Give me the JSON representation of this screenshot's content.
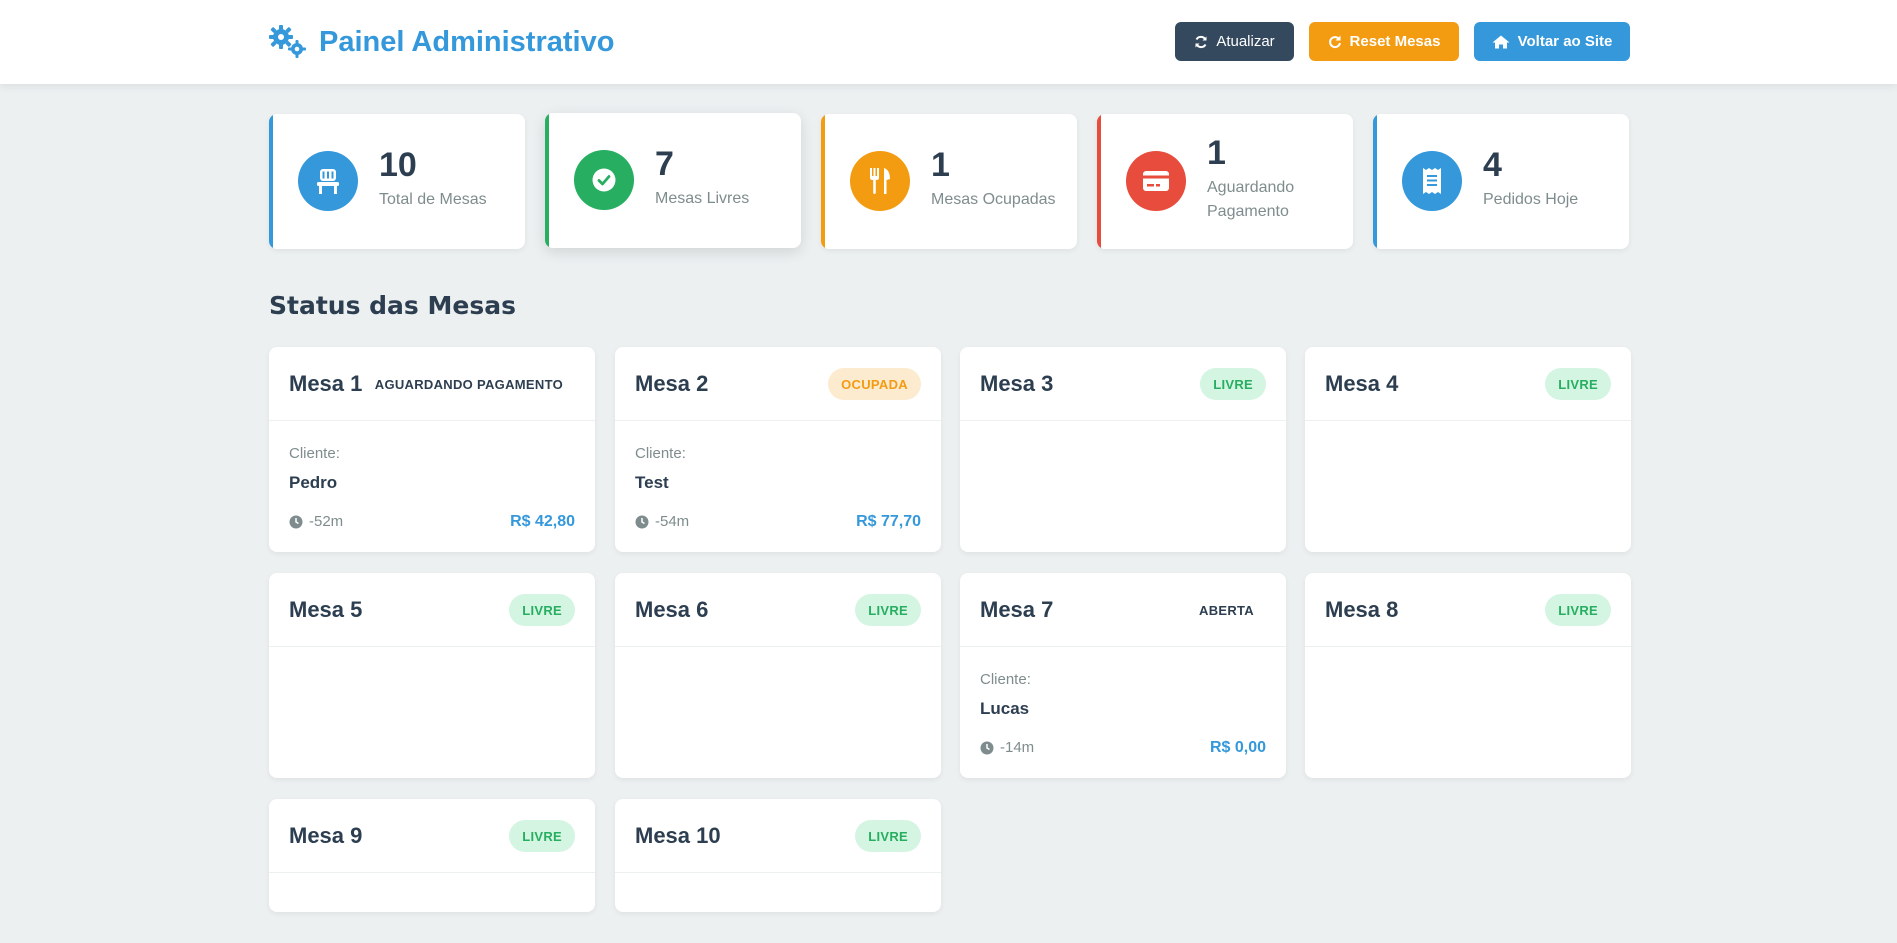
{
  "header": {
    "title": "Painel Administrativo",
    "buttons": {
      "refresh": "Atualizar",
      "reset": "Reset Mesas",
      "home": "Voltar ao Site"
    }
  },
  "stats": [
    {
      "value": "10",
      "label": "Total de Mesas",
      "icon": "chair-icon",
      "color": "#3498db"
    },
    {
      "value": "7",
      "label": "Mesas Livres",
      "icon": "check-circle-icon",
      "color": "#27ae60"
    },
    {
      "value": "1",
      "label": "Mesas Ocupadas",
      "icon": "utensils-icon",
      "color": "#f39c12"
    },
    {
      "value": "1",
      "label": "Aguardando Pagamento",
      "icon": "credit-card-icon",
      "color": "#e74c3c"
    },
    {
      "value": "4",
      "label": "Pedidos Hoje",
      "icon": "receipt-icon",
      "color": "#3498db"
    }
  ],
  "section_title": "Status das Mesas",
  "client_label": "Cliente:",
  "mesas": [
    {
      "name": "Mesa 1",
      "status": "AGUARDANDO PAGAMENTO",
      "client": "Pedro",
      "time": "-52m",
      "value": "R$ 42,80"
    },
    {
      "name": "Mesa 2",
      "status": "OCUPADA",
      "client": "Test",
      "time": "-54m",
      "value": "R$ 77,70"
    },
    {
      "name": "Mesa 3",
      "status": "LIVRE"
    },
    {
      "name": "Mesa 4",
      "status": "LIVRE"
    },
    {
      "name": "Mesa 5",
      "status": "LIVRE"
    },
    {
      "name": "Mesa 6",
      "status": "LIVRE"
    },
    {
      "name": "Mesa 7",
      "status": "ABERTA",
      "client": "Lucas",
      "time": "-14m",
      "value": "R$ 0,00"
    },
    {
      "name": "Mesa 8",
      "status": "LIVRE"
    },
    {
      "name": "Mesa 9",
      "status": "LIVRE"
    },
    {
      "name": "Mesa 10",
      "status": "LIVRE"
    }
  ],
  "colors": {
    "primary": "#3498db",
    "success": "#27ae60",
    "warning": "#f39c12",
    "danger": "#e74c3c",
    "dark": "#34495e"
  }
}
